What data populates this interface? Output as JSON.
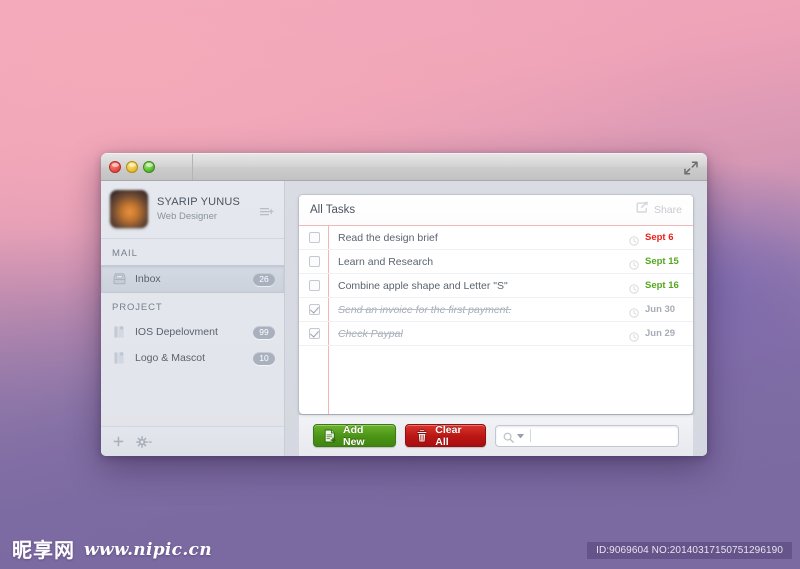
{
  "window": {
    "expand_icon": "fullscreen-expand-icon",
    "traffic_lights": [
      {
        "name": "close",
        "color": "#e4453c"
      },
      {
        "name": "minimize",
        "color": "#e8bb2c"
      },
      {
        "name": "zoom",
        "color": "#52b52b"
      }
    ]
  },
  "sidebar": {
    "user": {
      "name": "SYARIP YUNUS",
      "role": "Web Designer",
      "menu_icon": "list-add-icon",
      "avatar_icon": "user-avatar"
    },
    "sections": [
      {
        "label": "MAIL",
        "items": [
          {
            "label": "Inbox",
            "badge": "26",
            "icon": "inbox-tray-icon",
            "selected": true
          }
        ]
      },
      {
        "label": "PROJECT",
        "items": [
          {
            "label": "IOS Depelovment",
            "badge": "99",
            "icon": "book-icon",
            "selected": false
          },
          {
            "label": "Logo & Mascot",
            "badge": "10",
            "icon": "book-icon",
            "selected": false
          }
        ]
      }
    ],
    "footer": {
      "add_label": "+",
      "add_icon": "plus-icon",
      "settings_icon": "gear-icon",
      "settings_caret": "chevron-down-icon"
    }
  },
  "main": {
    "card_title": "All Tasks",
    "share_label": "Share",
    "share_icon": "share-export-icon",
    "tasks": [
      {
        "text": "Read the design brief",
        "date": "Sept 6",
        "date_color": "#e8231d",
        "done": false,
        "clock_icon": "clock-icon"
      },
      {
        "text": "Learn and Research",
        "date": "Sept 15",
        "date_color": "#54a81e",
        "done": false,
        "clock_icon": "clock-icon"
      },
      {
        "text": "Combine apple shape and Letter \"S\"",
        "date": "Sept 16",
        "date_color": "#54a81e",
        "done": false,
        "clock_icon": "clock-icon"
      },
      {
        "text": "Send an invoice for the first payment.",
        "date": "Jun 30",
        "date_color": "#a6adb7",
        "done": true,
        "clock_icon": "clock-icon"
      },
      {
        "text": "Check Paypal",
        "date": "Jun 29",
        "date_color": "#a6adb7",
        "done": true,
        "clock_icon": "clock-icon"
      }
    ]
  },
  "toolbar": {
    "add_label": "Add New",
    "add_icon": "new-document-icon",
    "add_color": "#4c9516",
    "clear_label": "Clear All",
    "clear_icon": "trash-icon",
    "clear_color": "#bb1714",
    "search": {
      "value": "",
      "placeholder": "",
      "icon": "search-magnifier-icon",
      "caret_icon": "chevron-down-icon"
    }
  },
  "watermark": {
    "cn_text": "昵享网",
    "url_text": "www.nipic.cn",
    "id_text": "ID:9069604 NO:20140317150751296190"
  }
}
